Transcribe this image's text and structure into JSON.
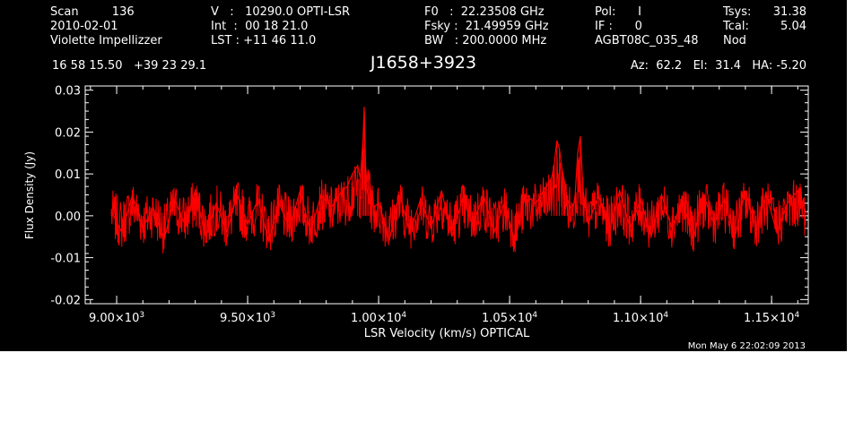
{
  "header": {
    "col1": {
      "line1": "Scan         136",
      "line2": "2010-02-01",
      "line3": "Violette Impellizzer"
    },
    "col2": {
      "line1": "V   :   10290.0 OPTI-LSR",
      "line2": "Int  :  00 18 21.0",
      "line3": "LST : +11 46 11.0"
    },
    "col3": {
      "line1": "F0   :  22.23508 GHz",
      "line2": "Fsky :  21.49959 GHz",
      "line3": "BW   : 200.0000 MHz"
    },
    "col4": {
      "line1": "Pol:      I",
      "line2": "IF :      0",
      "line3": "AGBT08C_035_48"
    },
    "col5": {
      "line1": "Tsys:",
      "line2": "Tcal:",
      "line3": "Nod"
    },
    "col6": {
      "line1": "31.38",
      "line2": "5.04"
    },
    "coords": "16 58 15.50   +39 23 29.1",
    "source": "J1658+3923",
    "pointing": "Az:  62.2   El:  31.4   HA: -5.20",
    "date": "Mon May  6 22:02:09 2013"
  },
  "colors": {
    "background": "#000000",
    "axes": "#ffffff",
    "spectrum": "#ff0000"
  },
  "chart_data": {
    "type": "line",
    "xlabel": "LSR Velocity (km/s) OPTICAL",
    "ylabel": "Flux Density (Jy)",
    "xlim": [
      8880,
      11640
    ],
    "ylim": [
      -0.021,
      0.031
    ],
    "xticks": [
      {
        "value": 9000,
        "mantissa": "9.00",
        "exp": "3"
      },
      {
        "value": 9500,
        "mantissa": "9.50",
        "exp": "3"
      },
      {
        "value": 10000,
        "mantissa": "1.00",
        "exp": "4"
      },
      {
        "value": 10500,
        "mantissa": "1.05",
        "exp": "4"
      },
      {
        "value": 11000,
        "mantissa": "1.10",
        "exp": "4"
      },
      {
        "value": 11500,
        "mantissa": "1.15",
        "exp": "4"
      }
    ],
    "yticks": [
      {
        "value": -0.02,
        "label": "-0.02"
      },
      {
        "value": -0.01,
        "label": "-0.01"
      },
      {
        "value": 0.0,
        "label": "0.00"
      },
      {
        "value": 0.01,
        "label": "0.01"
      },
      {
        "value": 0.02,
        "label": "0.02"
      },
      {
        "value": 0.03,
        "label": "0.03"
      }
    ],
    "series": [
      {
        "x": [
          8980,
          9020,
          9060,
          9100,
          9140,
          9180,
          9220,
          9260,
          9300,
          9340,
          9380,
          9420,
          9460,
          9500,
          9540,
          9580,
          9620,
          9660,
          9700,
          9740,
          9780,
          9820,
          9860,
          9880,
          9900,
          9920,
          9930,
          9940,
          9945,
          9950,
          9955,
          9960,
          9970,
          9980,
          10000,
          10040,
          10080,
          10120,
          10160,
          10200,
          10240,
          10280,
          10320,
          10360,
          10400,
          10440,
          10480,
          10520,
          10560,
          10600,
          10620,
          10640,
          10660,
          10670,
          10680,
          10690,
          10700,
          10710,
          10720,
          10740,
          10750,
          10760,
          10770,
          10780,
          10800,
          10840,
          10880,
          10920,
          10960,
          11000,
          11040,
          11080,
          11120,
          11160,
          11200,
          11240,
          11280,
          11320,
          11360,
          11400,
          11440,
          11480,
          11520,
          11560,
          11600,
          11630
        ],
        "y": [
          0.001,
          -0.004,
          0.005,
          -0.003,
          0.002,
          -0.006,
          0.004,
          -0.002,
          0.006,
          -0.005,
          0.003,
          -0.004,
          0.005,
          -0.002,
          0.004,
          -0.006,
          0.003,
          -0.003,
          0.006,
          -0.004,
          0.005,
          0.002,
          0.006,
          0.007,
          0.01,
          0.012,
          0.009,
          0.018,
          0.026,
          0.012,
          0.008,
          0.011,
          0.006,
          0.002,
          0.003,
          -0.006,
          0.005,
          -0.004,
          0.004,
          -0.003,
          0.006,
          -0.005,
          0.004,
          -0.002,
          0.005,
          -0.004,
          0.003,
          -0.006,
          0.005,
          0.003,
          0.005,
          0.007,
          0.009,
          0.012,
          0.018,
          0.016,
          0.011,
          0.008,
          0.004,
          0.001,
          0.005,
          0.015,
          0.019,
          0.006,
          -0.002,
          0.005,
          -0.004,
          0.006,
          -0.003,
          0.004,
          -0.005,
          0.005,
          -0.003,
          0.004,
          -0.006,
          0.005,
          -0.002,
          0.004,
          -0.005,
          0.006,
          -0.003,
          0.005,
          -0.004,
          0.003,
          0.006,
          0.001
        ]
      }
    ]
  }
}
